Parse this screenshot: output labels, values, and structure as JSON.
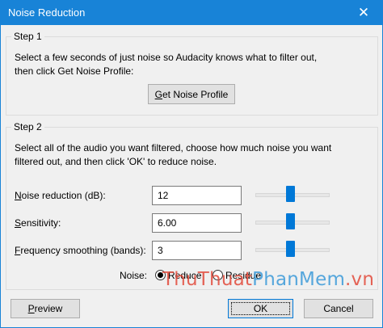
{
  "window": {
    "title": "Noise Reduction",
    "close_glyph": "✕"
  },
  "step1": {
    "label": "Step 1",
    "description_line1": "Select a few seconds of just noise so Audacity knows what to filter out,",
    "description_line2": "then click Get Noise Profile:",
    "button_accel": "G",
    "button_rest": "et Noise Profile"
  },
  "step2": {
    "label": "Step 2",
    "description_line1": "Select all of the audio you want filtered, choose how much noise you want",
    "description_line2": "filtered out, and then click 'OK' to reduce noise.",
    "fields": [
      {
        "accel": "N",
        "rest": "oise reduction (dB):",
        "value": "12",
        "slider_fraction": 0.48
      },
      {
        "accel": "S",
        "rest": "ensitivity:",
        "value": "6.00",
        "slider_fraction": 0.48
      },
      {
        "accel": "F",
        "rest": "requency smoothing (bands):",
        "value": "3",
        "slider_fraction": 0.48
      }
    ],
    "noise_label": "Noise:",
    "radio_options": [
      {
        "label": "Reduce",
        "checked": true
      },
      {
        "label": "Residue",
        "checked": false
      }
    ]
  },
  "buttons": {
    "preview_accel": "P",
    "preview_rest": "review",
    "ok": "OK",
    "cancel": "Cancel"
  },
  "watermark": {
    "part1": "ThuThuat",
    "part2": "PhanMem",
    "part3": ".vn"
  }
}
